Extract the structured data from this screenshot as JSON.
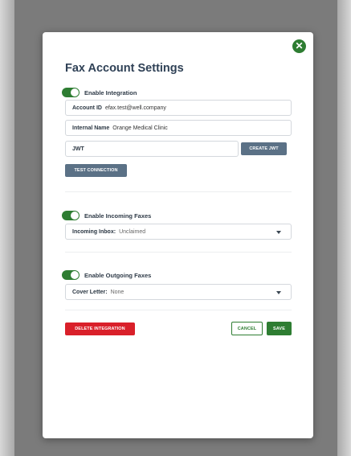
{
  "modal": {
    "title": "Fax Account Settings",
    "close_label": "✕"
  },
  "integration": {
    "toggle_label": "Enable Integration",
    "toggle_on": true,
    "account_id_label": "Account ID",
    "account_id_value": "efax.test@well.company",
    "internal_name_label": "Internal Name",
    "internal_name_value": "Orange Medical Clinic",
    "jwt_value": "JWT",
    "create_jwt_label": "CREATE JWT",
    "test_connection_label": "TEST CONNECTION"
  },
  "incoming": {
    "toggle_label": "Enable Incoming Faxes",
    "toggle_on": true,
    "inbox_label": "Incoming Inbox:",
    "inbox_value": "Unclaimed"
  },
  "outgoing": {
    "toggle_label": "Enable Outgoing Faxes",
    "toggle_on": true,
    "cover_letter_label": "Cover Letter:",
    "cover_letter_value": "None"
  },
  "footer": {
    "delete_label": "DELETE INTEGRATION",
    "cancel_label": "CANCEL",
    "save_label": "SAVE"
  },
  "colors": {
    "accent_green": "#2e7d32",
    "danger_red": "#d9202a",
    "slate_button": "#5b7186",
    "title_text": "#2f4156"
  }
}
